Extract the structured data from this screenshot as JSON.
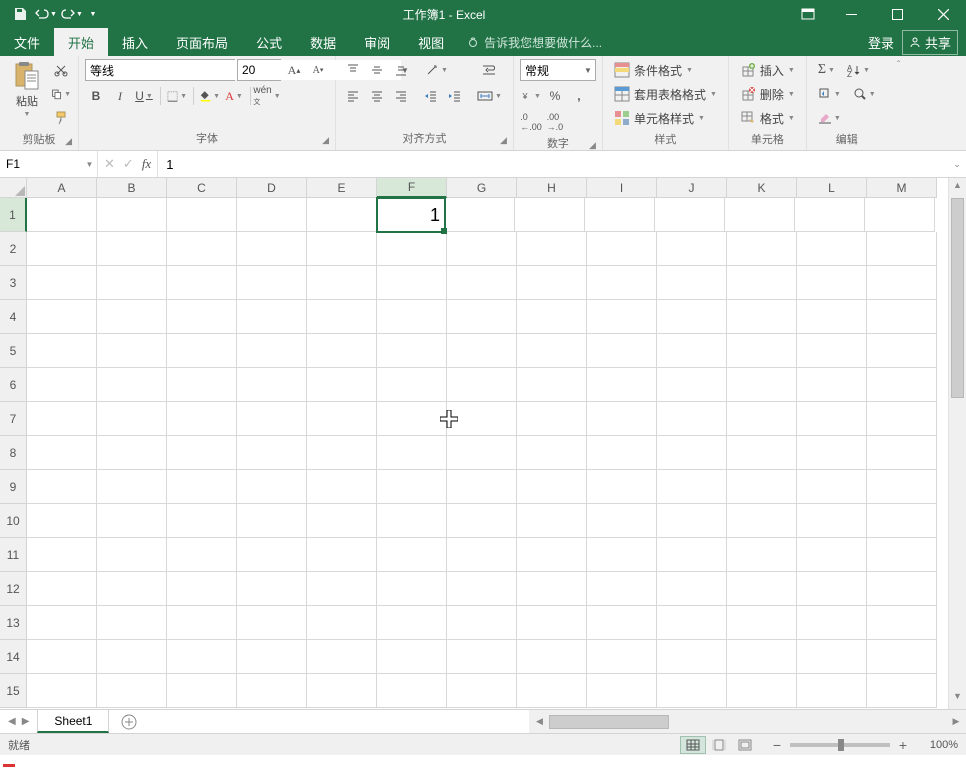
{
  "title": "工作簿1 - Excel",
  "tabs": {
    "file": "文件",
    "home": "开始",
    "insert": "插入",
    "pageLayout": "页面布局",
    "formulas": "公式",
    "data": "数据",
    "review": "审阅",
    "view": "视图"
  },
  "tellme": "告诉我您想要做什么...",
  "login": "登录",
  "share": "共享",
  "ribbon": {
    "clipboard": {
      "label": "剪贴板",
      "paste": "粘贴"
    },
    "font": {
      "label": "字体",
      "name": "等线",
      "size": "20"
    },
    "alignment": {
      "label": "对齐方式"
    },
    "number": {
      "label": "数字",
      "format": "常规"
    },
    "styles": {
      "label": "样式",
      "conditional": "条件格式",
      "tableStyle": "套用表格格式",
      "cellStyle": "单元格样式"
    },
    "cells": {
      "label": "单元格",
      "insert": "插入",
      "delete": "删除",
      "format": "格式"
    },
    "editing": {
      "label": "编辑"
    }
  },
  "namebox": "F1",
  "formula": "1",
  "columns": [
    "A",
    "B",
    "C",
    "D",
    "E",
    "F",
    "G",
    "H",
    "I",
    "J",
    "K",
    "L",
    "M"
  ],
  "rows": [
    "1",
    "2",
    "3",
    "4",
    "5",
    "6",
    "7",
    "8",
    "9",
    "10",
    "11",
    "12",
    "13",
    "14",
    "15"
  ],
  "activeCell": {
    "col": "F",
    "row": 1,
    "value": "1"
  },
  "sheet": "Sheet1",
  "status": "就绪",
  "zoom": "100%"
}
